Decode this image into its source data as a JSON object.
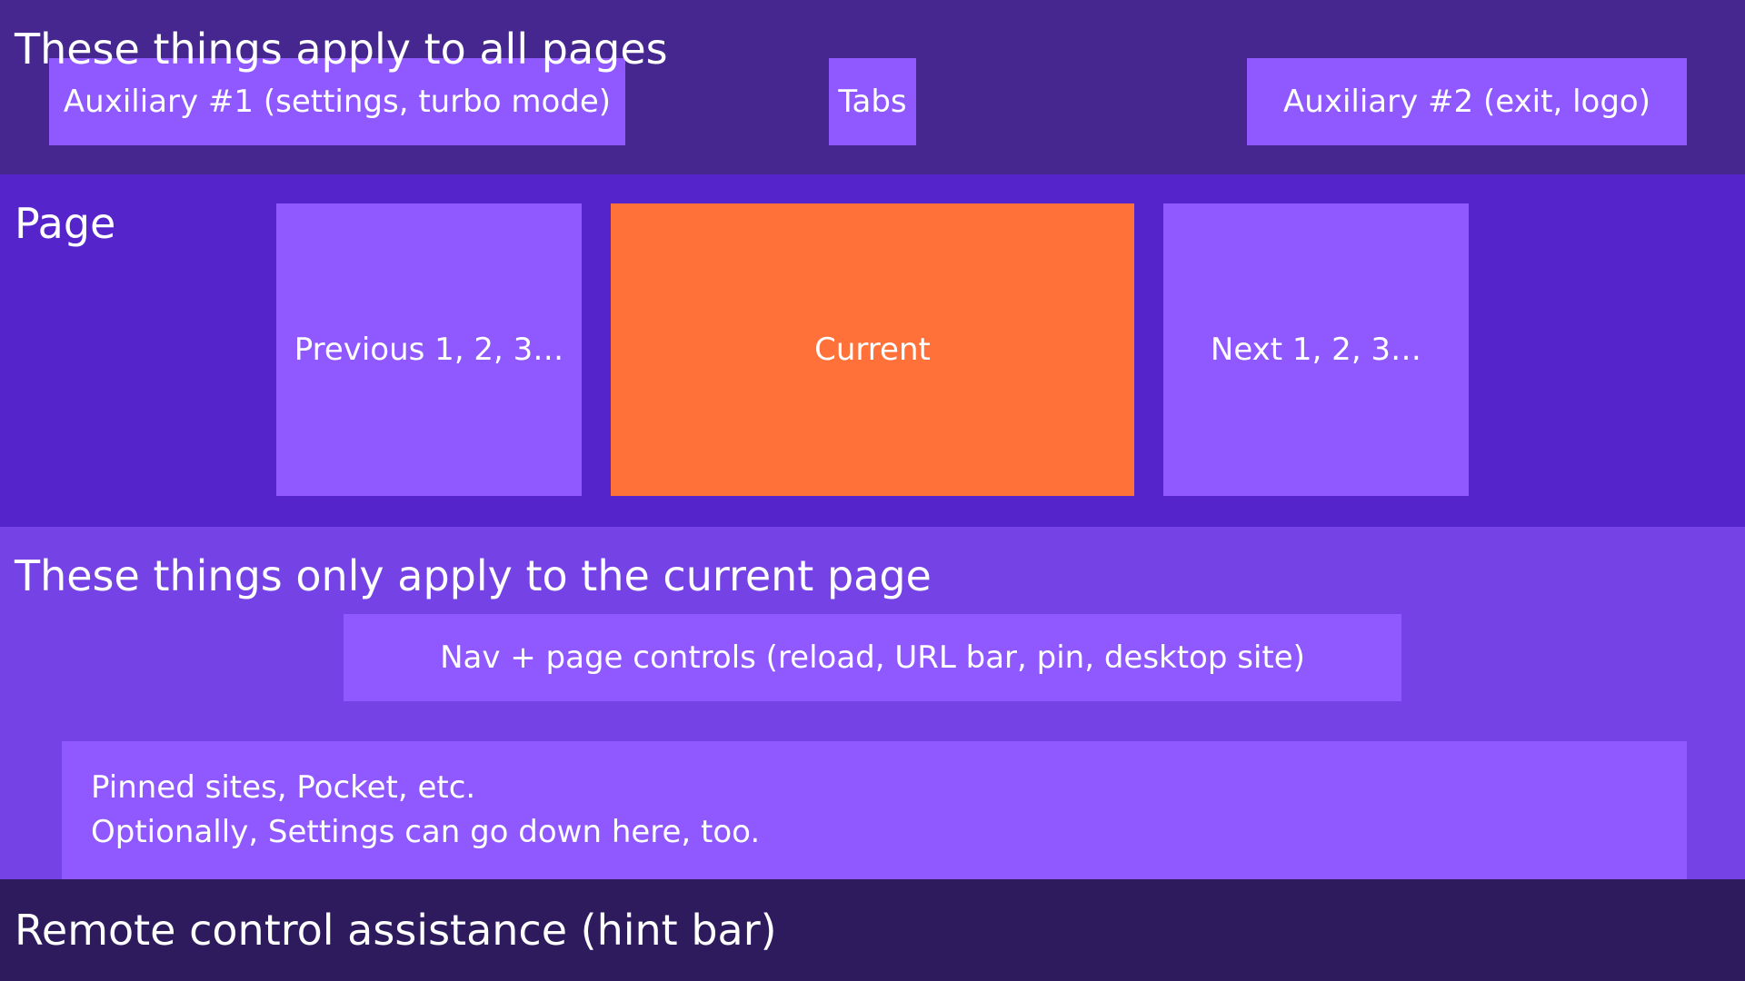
{
  "sections": {
    "all_pages": {
      "heading": "These things apply to all pages",
      "auxiliary_1": "Auxiliary #1 (settings, turbo mode)",
      "tabs": "Tabs",
      "auxiliary_2": "Auxiliary #2 (exit, logo)"
    },
    "page": {
      "heading": "Page",
      "previous": "Previous 1, 2, 3…",
      "current": "Current",
      "next": "Next 1, 2, 3…"
    },
    "current_page": {
      "heading": "These things only apply to the current page",
      "nav_controls": "Nav + page controls (reload, URL bar, pin, desktop site)",
      "pinned_line1": "Pinned sites, Pocket, etc.",
      "pinned_line2": "Optionally, Settings can go down here, too."
    },
    "hint_bar": {
      "heading": "Remote control assistance (hint bar)"
    }
  },
  "colors": {
    "top_band": "#45278f",
    "page_band": "#5524cb",
    "current_band": "#7542e5",
    "hint_band": "#2d1b5e",
    "box": "#9059ff",
    "current_box": "#ff7139"
  }
}
